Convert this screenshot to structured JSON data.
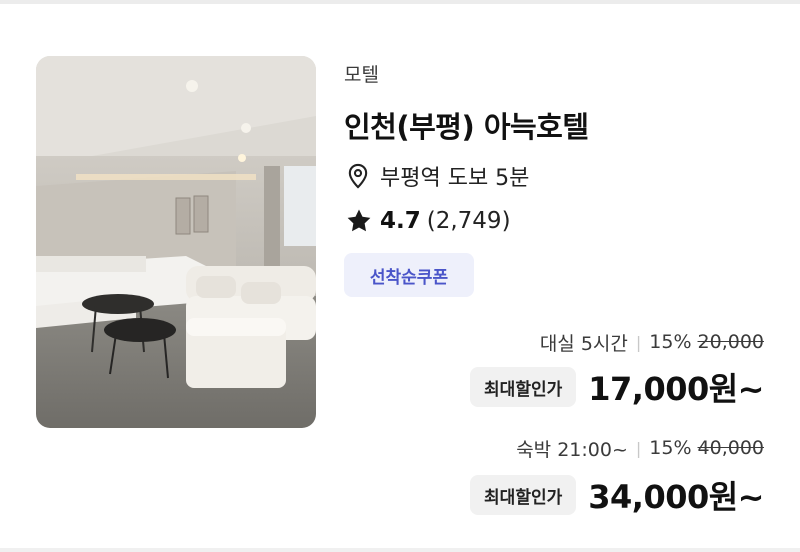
{
  "listing": {
    "category": "모텔",
    "name": "인천(부평) 아늑호텔",
    "location": {
      "icon": "map-pin-icon",
      "text": "부평역 도보 5분"
    },
    "rating": {
      "icon": "star-icon",
      "score": "4.7",
      "count": "(2,749)"
    },
    "coupon_label": "선착순쿠폰"
  },
  "prices": {
    "rent": {
      "label": "대실 5시간",
      "discount": "15%",
      "original": "20,000",
      "badge": "최대할인가",
      "final": "17,000원~"
    },
    "stay": {
      "label": "숙박 21:00~",
      "discount": "15%",
      "original": "40,000",
      "badge": "최대할인가",
      "final": "34,000원~"
    }
  },
  "colors": {
    "coupon_bg": "#eef0fb",
    "coupon_text": "#4a55c9",
    "badge_bg": "#f1f1f1"
  }
}
